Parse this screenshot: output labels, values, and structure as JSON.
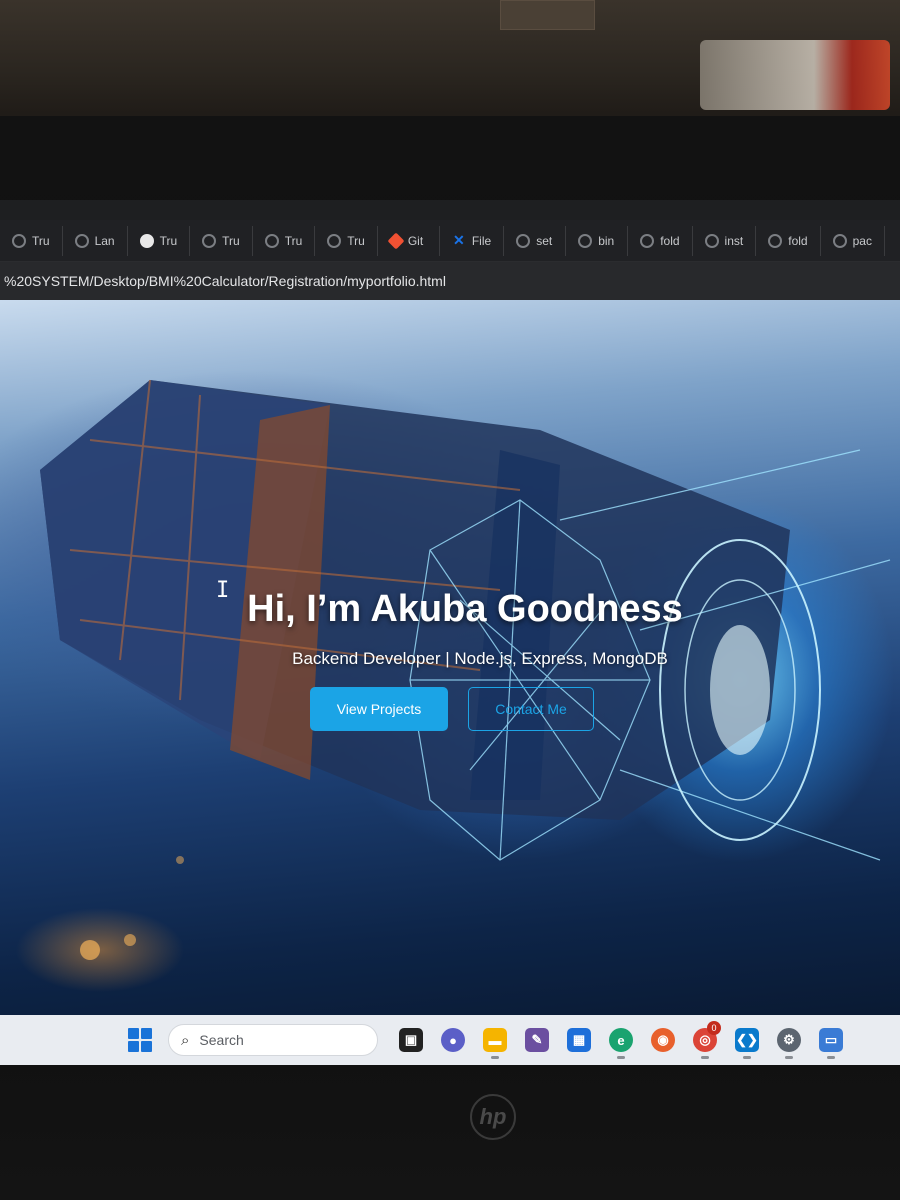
{
  "browser": {
    "tabs": [
      {
        "label": "Tru",
        "icon": "globe-icon"
      },
      {
        "label": "Lan",
        "icon": "globe-icon"
      },
      {
        "label": "Tru",
        "icon": "github-icon"
      },
      {
        "label": "Tru",
        "icon": "globe-icon"
      },
      {
        "label": "Tru",
        "icon": "globe-icon"
      },
      {
        "label": "Tru",
        "icon": "globe-icon"
      },
      {
        "label": "Git",
        "icon": "git-icon"
      },
      {
        "label": "File",
        "icon": "file-icon"
      },
      {
        "label": "set",
        "icon": "globe-icon"
      },
      {
        "label": "bin",
        "icon": "globe-icon"
      },
      {
        "label": "fold",
        "icon": "globe-icon"
      },
      {
        "label": "inst",
        "icon": "globe-icon"
      },
      {
        "label": "fold",
        "icon": "globe-icon"
      },
      {
        "label": "pac",
        "icon": "globe-icon"
      }
    ],
    "address": "%20SYSTEM/Desktop/BMI%20Calculator/Registration/myportfolio.html"
  },
  "hero": {
    "title": "Hi, I’m Akuba Goodness",
    "subtitle": "Backend Developer | Node.js, Express, MongoDB",
    "primary_button": "View Projects",
    "secondary_button": "Contact Me"
  },
  "taskbar": {
    "search_placeholder": "Search",
    "apps": [
      {
        "name": "task-view-icon",
        "color": "#222222"
      },
      {
        "name": "teams-icon",
        "color": "#5b5fc7"
      },
      {
        "name": "file-explorer-icon",
        "color": "#f5b400"
      },
      {
        "name": "notepad-icon",
        "color": "#6b4fa0"
      },
      {
        "name": "store-icon",
        "color": "#1e6fd9"
      },
      {
        "name": "edge-icon",
        "color": "#1aa36f"
      },
      {
        "name": "firefox-icon",
        "color": "#e8602c"
      },
      {
        "name": "chrome-icon",
        "color": "#db4437",
        "badge": "0"
      },
      {
        "name": "vscode-icon",
        "color": "#0a7acc"
      },
      {
        "name": "settings-icon",
        "color": "#5c6570"
      },
      {
        "name": "app-window-icon",
        "color": "#3a7bd5"
      }
    ]
  },
  "brand": {
    "logo": "hp"
  },
  "colors": {
    "accent": "#1ba4e6",
    "taskbar": "#e9ecf1",
    "browser_chrome": "#202124"
  }
}
